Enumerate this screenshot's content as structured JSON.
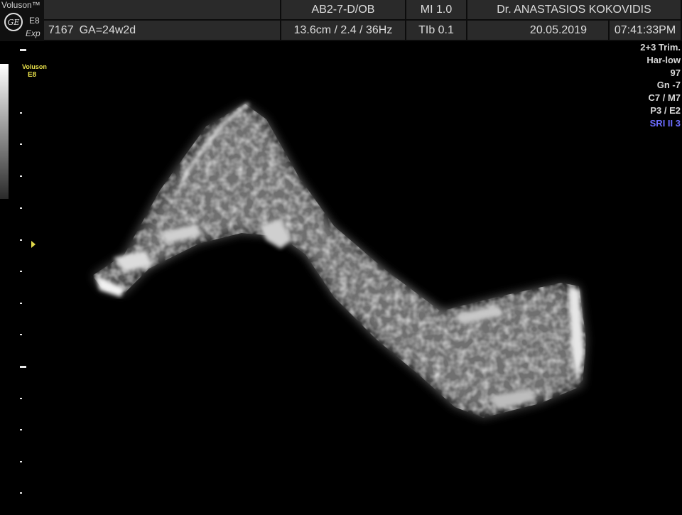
{
  "header": {
    "brand": "Voluson™",
    "model": "E8",
    "mode": "Exp",
    "logo_text": "GE",
    "probe": "AB2-7-D/OB",
    "mi": "MI  1.0",
    "physician": "Dr. ANASTASIOS KOKOVIDIS",
    "patient_id": "7167",
    "gestational_age": "GA=24w2d",
    "depth_freq": "13.6cm / 2.4 / 36Hz",
    "tib": "TIb  0.1",
    "date": "20.05.2019",
    "time": "07:41:33PM"
  },
  "side_logo": {
    "line1": "Voluson",
    "line2": "E8"
  },
  "params": {
    "preset": "2+3 Trim.",
    "harmonic": "Har-low",
    "power": "97",
    "gain": "Gn  -7",
    "cm": "C7 / M7",
    "pe": "P3 / E2",
    "sri": "SRI II 3"
  },
  "colors": {
    "sri_accent": "#6c6cff",
    "marker_yellow": "#e0d84a",
    "header_bg": "#2a2a2a"
  }
}
